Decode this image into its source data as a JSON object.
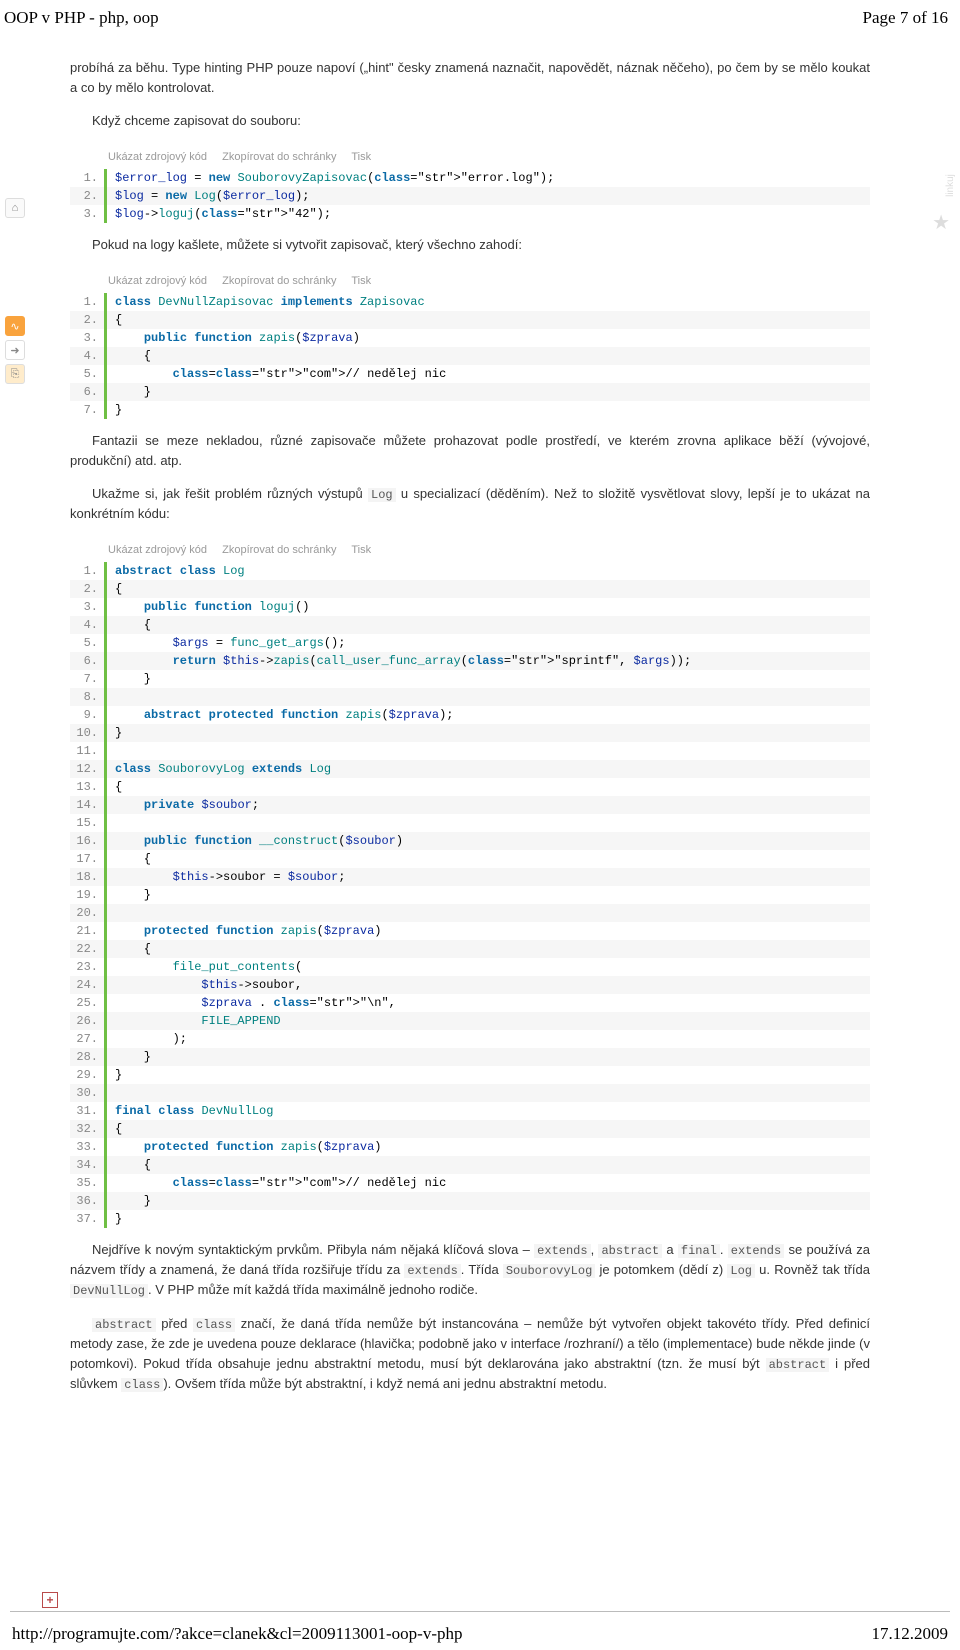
{
  "header": {
    "title_left": "OOP v PHP - php, oop",
    "title_right": "Page 7 of 16"
  },
  "tools_labels": {
    "show": "Ukázat zdrojový kód",
    "copy": "Zkopírovat do schránky",
    "print": "Tisk"
  },
  "paragraphs": {
    "p1_a": "probíhá za běhu. Type hinting PHP pouze napoví („hint\" česky znamená naznačit, napovědět, náznak něčeho), po čem by se mělo koukat a co by mělo kontrolovat.",
    "p2": "Když chceme zapisovat do souboru:",
    "p3": "Pokud na logy kašlete, můžete si vytvořit zapisovač, který všechno zahodí:",
    "p4": "Fantazii se meze nekladou, různé zapisovače můžete prohazovat podle prostředí, ve kterém zrovna aplikace běží (vývojové, produkční) atd. atp.",
    "p5_a": "Ukažme si, jak řešit problém různých výstupů ",
    "p5_b": " u specializací (děděním). Než to složitě vysvětlovat slovy, lepší je to ukázat na konkrétním kódu:",
    "p6_a": "Nejdříve k novým syntaktickým prvkům. Přibyla nám nějaká klíčová slova – ",
    "p6_b": " a ",
    "p6_c": " se používá za názvem třídy a znamená, že daná třída rozšiřuje třídu za ",
    "p6_d": ". Třída ",
    "p6_e": " je potomkem (dědí z) ",
    "p6_f": " u. Rovněž tak třída ",
    "p6_g": ". V PHP může mít každá třída maximálně jednoho rodiče.",
    "p7_a": " před ",
    "p7_b": " značí, že daná třída nemůže být instancována – nemůže být vytvořen objekt takovéto třídy. Před definicí metody zase, že zde je uvedena pouze deklarace (hlavička; podobně jako v interface /rozhraní/) a tělo (implementace) bude někde jinde (v potomkovi). Pokud třída obsahuje jednu abstraktní metodu, musí být deklarována jako abstraktní (tzn. že musí být ",
    "p7_c": " i před slůvkem ",
    "p7_d": "). Ovšem třída může být abstraktní, i když nemá ani jednu abstraktní metodu."
  },
  "inline": {
    "Log": "Log",
    "extends": "extends",
    "abstract": "abstract",
    "final": "final",
    "SouborovyLog": "SouborovyLog",
    "DevNullLog": "DevNullLog",
    "class": "class"
  },
  "code1": [
    "$error_log = new SouborovyZapisovac(\"error.log\");",
    "$log = new Log($error_log);",
    "$log->loguj(\"42\");"
  ],
  "code2": [
    "class DevNullZapisovac implements Zapisovac",
    "{",
    "    public function zapis($zprava)",
    "    {",
    "        // nedělej nic",
    "    }",
    "}"
  ],
  "code3": [
    "abstract class Log",
    "{",
    "    public function loguj()",
    "    {",
    "        $args = func_get_args();",
    "        return $this->zapis(call_user_func_array(\"sprintf\", $args));",
    "    }",
    "",
    "    abstract protected function zapis($zprava);",
    "}",
    "",
    "class SouborovyLog extends Log",
    "{",
    "    private $soubor;",
    "",
    "    public function __construct($soubor)",
    "    {",
    "        $this->soubor = $soubor;",
    "    }",
    "",
    "    protected function zapis($zprava)",
    "    {",
    "        file_put_contents(",
    "            $this->soubor,",
    "            $zprava . \"\\n\",",
    "            FILE_APPEND",
    "        );",
    "    }",
    "}",
    "",
    "final class DevNullLog",
    "{",
    "    protected function zapis($zprava)",
    "    {",
    "        // nedělej nic",
    "    }",
    "}"
  ],
  "footer": {
    "url": "http://programujte.com/?akce=clanek&cl=2009113001-oop-v-php",
    "date": "17.12.2009"
  },
  "sidebar": {
    "label": "linkuj"
  }
}
